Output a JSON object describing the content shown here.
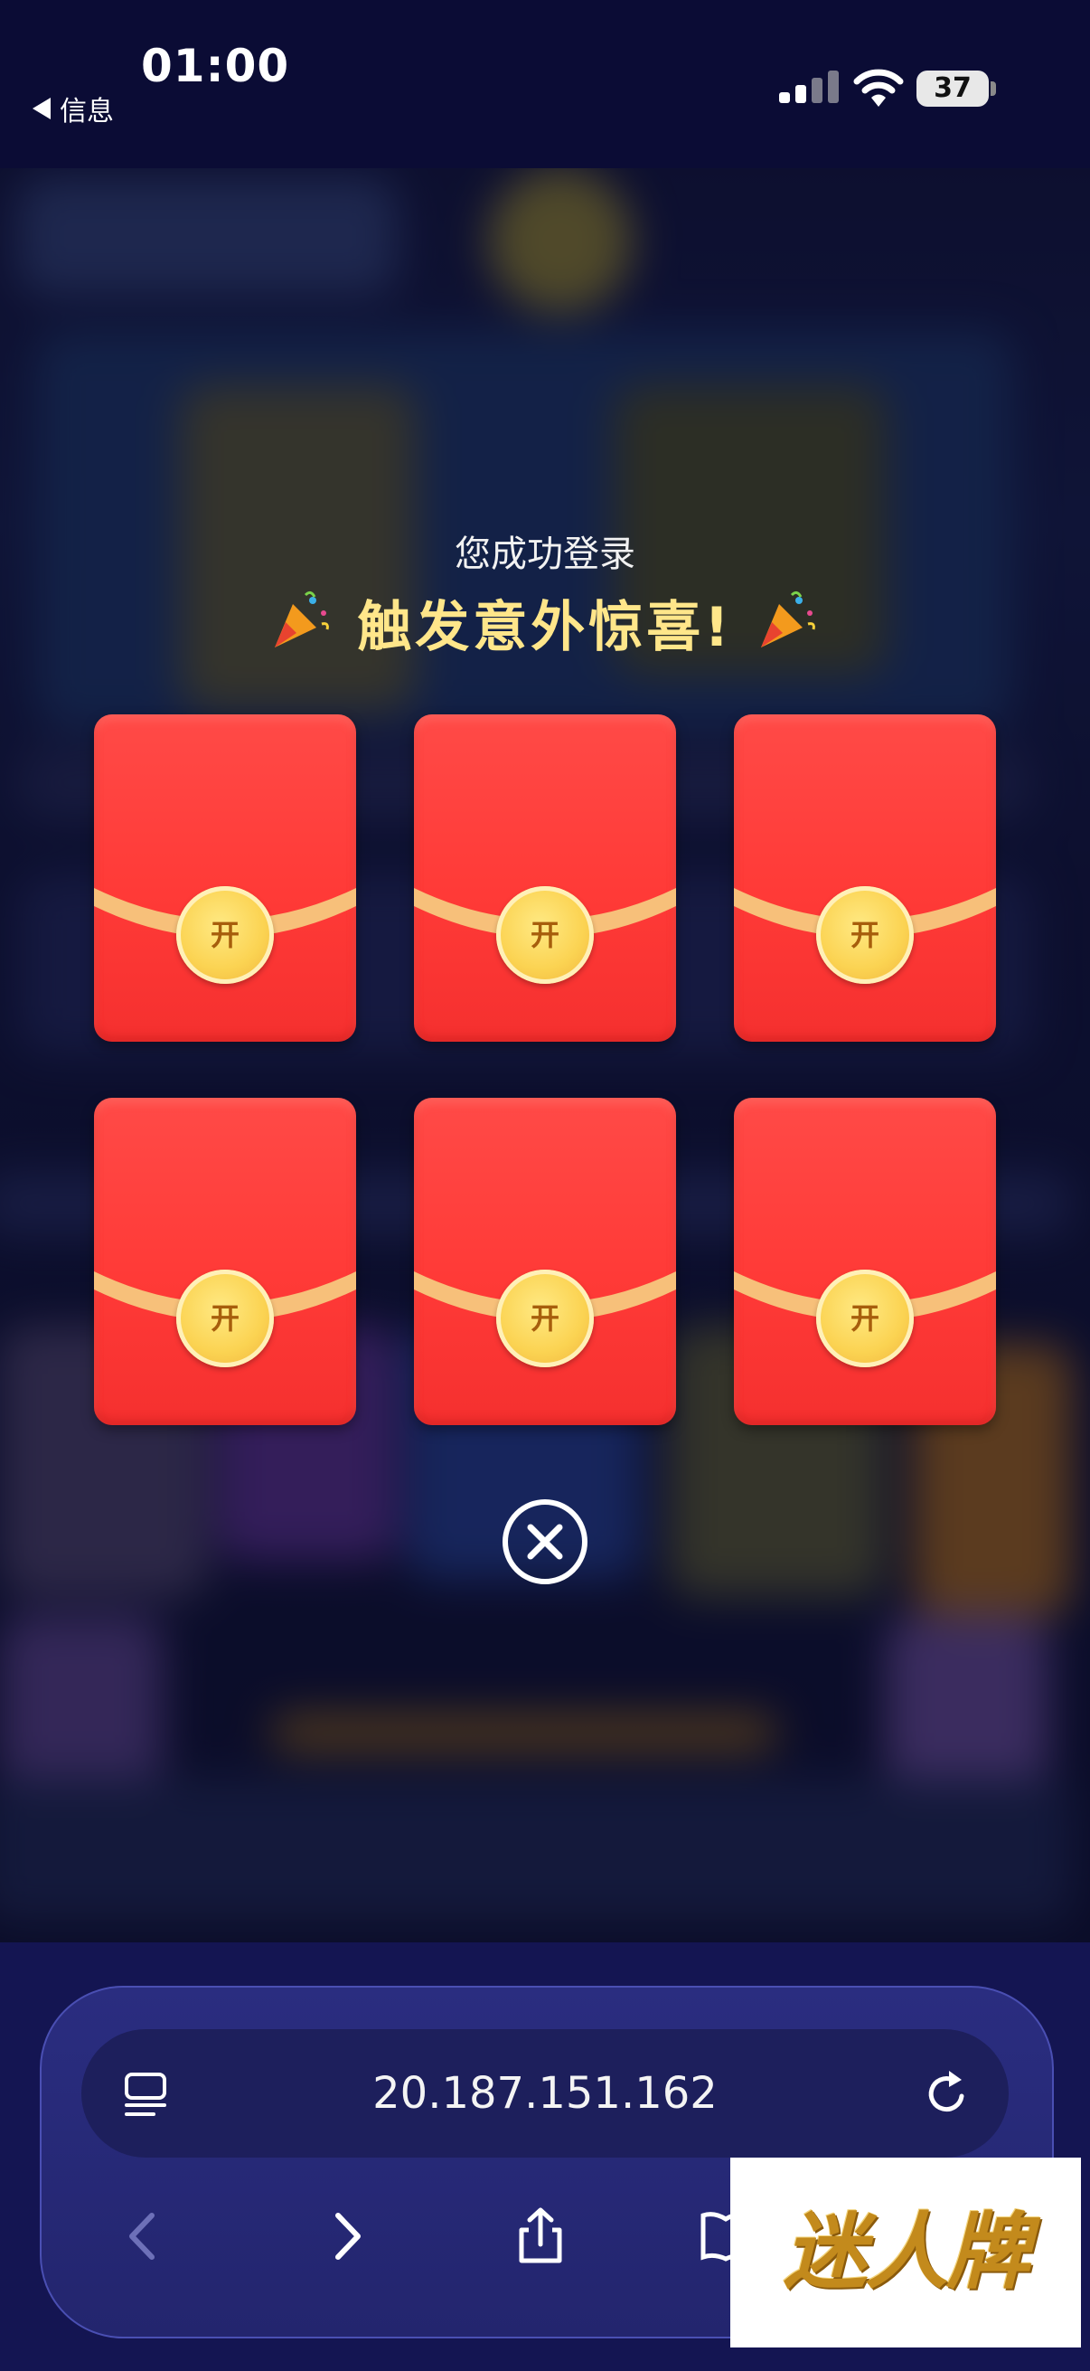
{
  "status_bar": {
    "time": "01:00",
    "back_app": "信息",
    "battery": "37"
  },
  "popup": {
    "subtitle": "您成功登录",
    "title": "触发意外惊喜!",
    "envelopes": [
      {
        "label": "开"
      },
      {
        "label": "开"
      },
      {
        "label": "开"
      },
      {
        "label": "开"
      },
      {
        "label": "开"
      },
      {
        "label": "开"
      }
    ]
  },
  "browser": {
    "url": "20.187.151.162"
  },
  "watermark": {
    "text": "迷人牌"
  },
  "colors": {
    "envelope_red": "#ff3d3a",
    "coin_gold": "#fbd352",
    "title_gold": "#ffe68a",
    "background_navy": "#0b0c35"
  }
}
